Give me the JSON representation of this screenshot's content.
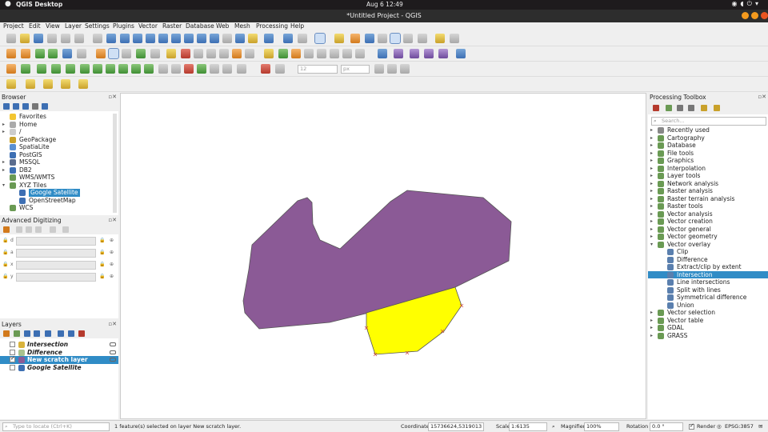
{
  "os": {
    "app_name": "QGIS Desktop",
    "clock": "Aug 6  12:49"
  },
  "window": {
    "title": "*Untitled Project - QGIS"
  },
  "menu": [
    "Project",
    "Edit",
    "View",
    "Layer",
    "Settings",
    "Plugins",
    "Vector",
    "Raster",
    "Database",
    "Web",
    "Mesh",
    "Processing",
    "Help"
  ],
  "digitize": {
    "font_size": "12",
    "unit": "px"
  },
  "browser": {
    "title": "Browser",
    "items": [
      {
        "label": "Favorites",
        "arrow": "",
        "icon": "star-icon",
        "color": "#f3c530",
        "indent": 0
      },
      {
        "label": "Home",
        "arrow": "▸",
        "icon": "home-folder-icon",
        "color": "#aaaaaa",
        "indent": 0
      },
      {
        "label": "/",
        "arrow": "▸",
        "icon": "root-folder-icon",
        "color": "#cccccc",
        "indent": 0
      },
      {
        "label": "GeoPackage",
        "arrow": "",
        "icon": "geopackage-icon",
        "color": "#c9a12a",
        "indent": 0
      },
      {
        "label": "SpatiaLite",
        "arrow": "",
        "icon": "spatialite-icon",
        "color": "#5a8fd1",
        "indent": 0
      },
      {
        "label": "PostGIS",
        "arrow": "",
        "icon": "postgis-icon",
        "color": "#3d6fb3",
        "indent": 0
      },
      {
        "label": "MSSQL",
        "arrow": "▸",
        "icon": "mssql-icon",
        "color": "#5a6c8e",
        "indent": 0
      },
      {
        "label": "DB2",
        "arrow": "▸",
        "icon": "db2-icon",
        "color": "#3d6fb3",
        "indent": 0
      },
      {
        "label": "WMS/WMTS",
        "arrow": "",
        "icon": "wms-icon",
        "color": "#6a9a54",
        "indent": 0
      },
      {
        "label": "XYZ Tiles",
        "arrow": "▾",
        "icon": "xyz-tiles-icon",
        "color": "#6a9a54",
        "indent": 0
      },
      {
        "label": "Google Satellite",
        "arrow": "",
        "icon": "tile-layer-icon",
        "color": "#3d6fb3",
        "indent": 1,
        "selected": true
      },
      {
        "label": "OpenStreetMap",
        "arrow": "",
        "icon": "tile-layer-icon",
        "color": "#3d6fb3",
        "indent": 1
      },
      {
        "label": "WCS",
        "arrow": "",
        "icon": "wcs-icon",
        "color": "#6a9a54",
        "indent": 0
      }
    ]
  },
  "advanced_digitizing": {
    "title": "Advanced Digitizing",
    "fields": [
      "d",
      "a",
      "x",
      "y"
    ]
  },
  "layers": {
    "title": "Layers",
    "items": [
      {
        "label": "Intersection",
        "checked": false,
        "color": "#d9b33c",
        "italic": true,
        "bold": true,
        "selected": false
      },
      {
        "label": "Difference",
        "checked": false,
        "color": "#a9c28e",
        "italic": true,
        "bold": true,
        "selected": false
      },
      {
        "label": "New scratch layer",
        "checked": true,
        "color": "#8b5a96",
        "italic": false,
        "bold": true,
        "selected": true
      },
      {
        "label": "Google Satellite",
        "checked": false,
        "color": "#3d6fb3",
        "italic": true,
        "bold": true,
        "selected": false
      }
    ]
  },
  "processing": {
    "title": "Processing Toolbox",
    "search_placeholder": "Search...",
    "items": [
      {
        "label": "Recently used",
        "arrow": "▸",
        "icon": "clock-icon",
        "indent": 0
      },
      {
        "label": "Cartography",
        "arrow": "▸",
        "icon": "qgis-icon",
        "indent": 0
      },
      {
        "label": "Database",
        "arrow": "▸",
        "icon": "qgis-icon",
        "indent": 0
      },
      {
        "label": "File tools",
        "arrow": "▸",
        "icon": "qgis-icon",
        "indent": 0
      },
      {
        "label": "Graphics",
        "arrow": "▸",
        "icon": "qgis-icon",
        "indent": 0
      },
      {
        "label": "Interpolation",
        "arrow": "▸",
        "icon": "qgis-icon",
        "indent": 0
      },
      {
        "label": "Layer tools",
        "arrow": "▸",
        "icon": "qgis-icon",
        "indent": 0
      },
      {
        "label": "Network analysis",
        "arrow": "▸",
        "icon": "qgis-icon",
        "indent": 0
      },
      {
        "label": "Raster analysis",
        "arrow": "▸",
        "icon": "qgis-icon",
        "indent": 0
      },
      {
        "label": "Raster terrain analysis",
        "arrow": "▸",
        "icon": "qgis-icon",
        "indent": 0
      },
      {
        "label": "Raster tools",
        "arrow": "▸",
        "icon": "qgis-icon",
        "indent": 0
      },
      {
        "label": "Vector analysis",
        "arrow": "▸",
        "icon": "qgis-icon",
        "indent": 0
      },
      {
        "label": "Vector creation",
        "arrow": "▸",
        "icon": "qgis-icon",
        "indent": 0
      },
      {
        "label": "Vector general",
        "arrow": "▸",
        "icon": "qgis-icon",
        "indent": 0
      },
      {
        "label": "Vector geometry",
        "arrow": "▸",
        "icon": "qgis-icon",
        "indent": 0
      },
      {
        "label": "Vector overlay",
        "arrow": "▾",
        "icon": "qgis-icon",
        "indent": 0
      },
      {
        "label": "Clip",
        "arrow": "",
        "icon": "clip-icon",
        "indent": 1
      },
      {
        "label": "Difference",
        "arrow": "",
        "icon": "difference-icon",
        "indent": 1
      },
      {
        "label": "Extract/clip by extent",
        "arrow": "",
        "icon": "extract-extent-icon",
        "indent": 1
      },
      {
        "label": "Intersection",
        "arrow": "",
        "icon": "intersection-icon",
        "indent": 1,
        "selected": true
      },
      {
        "label": "Line intersections",
        "arrow": "",
        "icon": "line-intersections-icon",
        "indent": 1
      },
      {
        "label": "Split with lines",
        "arrow": "",
        "icon": "split-lines-icon",
        "indent": 1
      },
      {
        "label": "Symmetrical difference",
        "arrow": "",
        "icon": "sym-difference-icon",
        "indent": 1
      },
      {
        "label": "Union",
        "arrow": "",
        "icon": "union-icon",
        "indent": 1
      },
      {
        "label": "Vector selection",
        "arrow": "▸",
        "icon": "qgis-icon",
        "indent": 0
      },
      {
        "label": "Vector table",
        "arrow": "▸",
        "icon": "qgis-icon",
        "indent": 0
      },
      {
        "label": "GDAL",
        "arrow": "▸",
        "icon": "gdal-icon",
        "indent": 0
      },
      {
        "label": "GRASS",
        "arrow": "▸",
        "icon": "grass-icon",
        "indent": 0
      }
    ]
  },
  "map": {
    "purple_fill": "#8b5a96",
    "yellow_fill": "#ffff00"
  },
  "status": {
    "locate_placeholder": "Type to locate (Ctrl+K)",
    "message": "1 feature(s) selected on layer New scratch layer.",
    "coordinate_label": "Coordinate",
    "coordinate": "15736624,5319013",
    "scale_label": "Scale",
    "scale": "1:6135",
    "magnifier_label": "Magnifier",
    "magnifier": "100%",
    "rotation_label": "Rotation",
    "rotation": "0.0 °",
    "render_label": "Render",
    "crs": "EPSG:3857"
  }
}
